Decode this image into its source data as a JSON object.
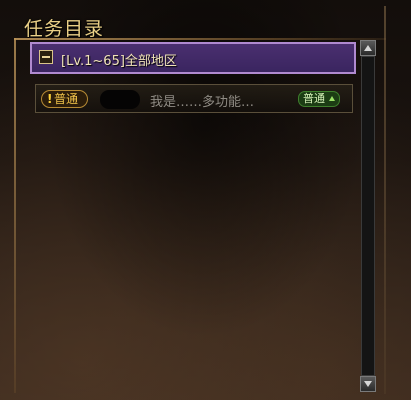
{
  "panel": {
    "title": "任务目录"
  },
  "quest_list": {
    "group": {
      "label": "[Lv.1~65]全部地区",
      "expanded": true
    },
    "quests": [
      {
        "type_badge": "普通",
        "type_badge_prefix": "!",
        "title": "我是……多功能…",
        "difficulty": "普通"
      }
    ]
  },
  "colors": {
    "title_gold": "#e9cf86",
    "group_bg": "#3a2560",
    "badge_gold": "#f0c24a",
    "difficulty_green": "#1c3d14"
  },
  "icons": {
    "collapse": "minus-box-icon",
    "scroll_up": "up-arrow-icon",
    "scroll_down": "down-arrow-icon",
    "difficulty_arrow": "up-triangle-icon"
  }
}
